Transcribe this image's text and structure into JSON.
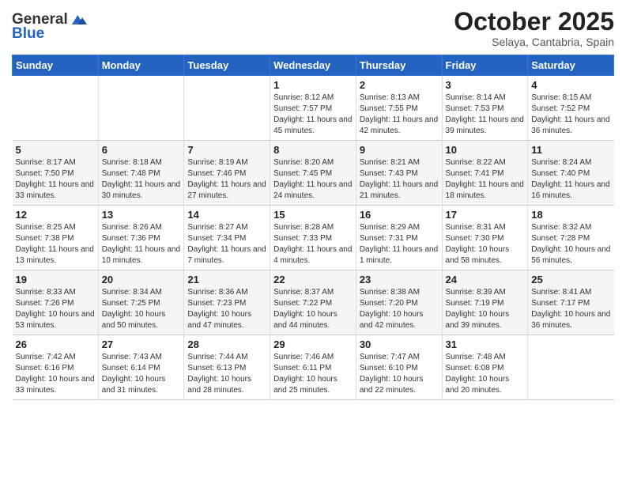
{
  "header": {
    "logo_line1": "General",
    "logo_line2": "Blue",
    "month": "October 2025",
    "location": "Selaya, Cantabria, Spain"
  },
  "weekdays": [
    "Sunday",
    "Monday",
    "Tuesday",
    "Wednesday",
    "Thursday",
    "Friday",
    "Saturday"
  ],
  "weeks": [
    [
      {
        "day": "",
        "info": ""
      },
      {
        "day": "",
        "info": ""
      },
      {
        "day": "",
        "info": ""
      },
      {
        "day": "1",
        "info": "Sunrise: 8:12 AM\nSunset: 7:57 PM\nDaylight: 11 hours and 45 minutes."
      },
      {
        "day": "2",
        "info": "Sunrise: 8:13 AM\nSunset: 7:55 PM\nDaylight: 11 hours and 42 minutes."
      },
      {
        "day": "3",
        "info": "Sunrise: 8:14 AM\nSunset: 7:53 PM\nDaylight: 11 hours and 39 minutes."
      },
      {
        "day": "4",
        "info": "Sunrise: 8:15 AM\nSunset: 7:52 PM\nDaylight: 11 hours and 36 minutes."
      }
    ],
    [
      {
        "day": "5",
        "info": "Sunrise: 8:17 AM\nSunset: 7:50 PM\nDaylight: 11 hours and 33 minutes."
      },
      {
        "day": "6",
        "info": "Sunrise: 8:18 AM\nSunset: 7:48 PM\nDaylight: 11 hours and 30 minutes."
      },
      {
        "day": "7",
        "info": "Sunrise: 8:19 AM\nSunset: 7:46 PM\nDaylight: 11 hours and 27 minutes."
      },
      {
        "day": "8",
        "info": "Sunrise: 8:20 AM\nSunset: 7:45 PM\nDaylight: 11 hours and 24 minutes."
      },
      {
        "day": "9",
        "info": "Sunrise: 8:21 AM\nSunset: 7:43 PM\nDaylight: 11 hours and 21 minutes."
      },
      {
        "day": "10",
        "info": "Sunrise: 8:22 AM\nSunset: 7:41 PM\nDaylight: 11 hours and 18 minutes."
      },
      {
        "day": "11",
        "info": "Sunrise: 8:24 AM\nSunset: 7:40 PM\nDaylight: 11 hours and 16 minutes."
      }
    ],
    [
      {
        "day": "12",
        "info": "Sunrise: 8:25 AM\nSunset: 7:38 PM\nDaylight: 11 hours and 13 minutes."
      },
      {
        "day": "13",
        "info": "Sunrise: 8:26 AM\nSunset: 7:36 PM\nDaylight: 11 hours and 10 minutes."
      },
      {
        "day": "14",
        "info": "Sunrise: 8:27 AM\nSunset: 7:34 PM\nDaylight: 11 hours and 7 minutes."
      },
      {
        "day": "15",
        "info": "Sunrise: 8:28 AM\nSunset: 7:33 PM\nDaylight: 11 hours and 4 minutes."
      },
      {
        "day": "16",
        "info": "Sunrise: 8:29 AM\nSunset: 7:31 PM\nDaylight: 11 hours and 1 minute."
      },
      {
        "day": "17",
        "info": "Sunrise: 8:31 AM\nSunset: 7:30 PM\nDaylight: 10 hours and 58 minutes."
      },
      {
        "day": "18",
        "info": "Sunrise: 8:32 AM\nSunset: 7:28 PM\nDaylight: 10 hours and 56 minutes."
      }
    ],
    [
      {
        "day": "19",
        "info": "Sunrise: 8:33 AM\nSunset: 7:26 PM\nDaylight: 10 hours and 53 minutes."
      },
      {
        "day": "20",
        "info": "Sunrise: 8:34 AM\nSunset: 7:25 PM\nDaylight: 10 hours and 50 minutes."
      },
      {
        "day": "21",
        "info": "Sunrise: 8:36 AM\nSunset: 7:23 PM\nDaylight: 10 hours and 47 minutes."
      },
      {
        "day": "22",
        "info": "Sunrise: 8:37 AM\nSunset: 7:22 PM\nDaylight: 10 hours and 44 minutes."
      },
      {
        "day": "23",
        "info": "Sunrise: 8:38 AM\nSunset: 7:20 PM\nDaylight: 10 hours and 42 minutes."
      },
      {
        "day": "24",
        "info": "Sunrise: 8:39 AM\nSunset: 7:19 PM\nDaylight: 10 hours and 39 minutes."
      },
      {
        "day": "25",
        "info": "Sunrise: 8:41 AM\nSunset: 7:17 PM\nDaylight: 10 hours and 36 minutes."
      }
    ],
    [
      {
        "day": "26",
        "info": "Sunrise: 7:42 AM\nSunset: 6:16 PM\nDaylight: 10 hours and 33 minutes."
      },
      {
        "day": "27",
        "info": "Sunrise: 7:43 AM\nSunset: 6:14 PM\nDaylight: 10 hours and 31 minutes."
      },
      {
        "day": "28",
        "info": "Sunrise: 7:44 AM\nSunset: 6:13 PM\nDaylight: 10 hours and 28 minutes."
      },
      {
        "day": "29",
        "info": "Sunrise: 7:46 AM\nSunset: 6:11 PM\nDaylight: 10 hours and 25 minutes."
      },
      {
        "day": "30",
        "info": "Sunrise: 7:47 AM\nSunset: 6:10 PM\nDaylight: 10 hours and 22 minutes."
      },
      {
        "day": "31",
        "info": "Sunrise: 7:48 AM\nSunset: 6:08 PM\nDaylight: 10 hours and 20 minutes."
      },
      {
        "day": "",
        "info": ""
      }
    ]
  ]
}
